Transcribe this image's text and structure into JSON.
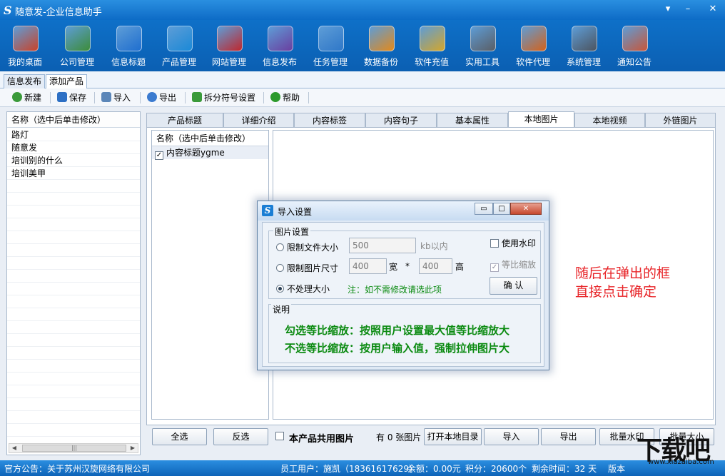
{
  "window": {
    "logo": "S",
    "title": "随意发-企业信息助手",
    "controls": [
      "▾",
      "–",
      "✕"
    ]
  },
  "main_toolbar": [
    {
      "label": "我的桌面",
      "icon": "home-icon",
      "color": "#c9442b"
    },
    {
      "label": "公司管理",
      "icon": "document-icon",
      "color": "#3d8d3a"
    },
    {
      "label": "信息标题",
      "icon": "info-icon",
      "color": "#1f6fd0"
    },
    {
      "label": "产品管理",
      "icon": "cloud-icon",
      "color": "#1b8ad8"
    },
    {
      "label": "网站管理",
      "icon": "building-icon",
      "color": "#c0282e"
    },
    {
      "label": "信息发布",
      "icon": "magic-wand-icon",
      "color": "#6b3fa0"
    },
    {
      "label": "任务管理",
      "icon": "bar-chart-icon",
      "color": "#2f78c9"
    },
    {
      "label": "数据备份",
      "icon": "upload-icon",
      "color": "#e38a1c"
    },
    {
      "label": "软件充值",
      "icon": "coins-icon",
      "color": "#d4a72c"
    },
    {
      "label": "实用工具",
      "icon": "tools-icon",
      "color": "#5b5f66"
    },
    {
      "label": "软件代理",
      "icon": "gift-icon",
      "color": "#d4631c"
    },
    {
      "label": "系统管理",
      "icon": "gear-icon",
      "color": "#4d5560"
    },
    {
      "label": "通知公告",
      "icon": "notebook-icon",
      "color": "#c8573a"
    }
  ],
  "outer_tabs": [
    "信息发布",
    "添加产品"
  ],
  "sub_toolbar": [
    {
      "label": "新建",
      "icon": "plus-icon",
      "color": "#3a9a3a"
    },
    {
      "label": "保存",
      "icon": "save-icon",
      "color": "#2c6fc4"
    },
    {
      "label": "导入",
      "icon": "folder-icon",
      "color": "#5b86b8"
    },
    {
      "label": "导出",
      "icon": "export-icon",
      "color": "#3b7bd0"
    },
    {
      "label": "拆分符号设置",
      "icon": "split-icon",
      "color": "#3a9a3a"
    },
    {
      "label": "帮助",
      "icon": "help-icon",
      "color": "#2c9a2c"
    }
  ],
  "left_list": {
    "header": "名称（选中后单击修改）",
    "items": [
      "路灯",
      "随意发",
      "培训别的什么",
      "培训美甲"
    ]
  },
  "right_tabs": [
    "产品标题",
    "详细介绍",
    "内容标签",
    "内容句子",
    "基本属性",
    "本地图片",
    "本地视频",
    "外链图片"
  ],
  "image_list": {
    "header": "名称（选中后单击修改）",
    "items": [
      {
        "label": "内容标题ygme",
        "checked": "✓"
      }
    ]
  },
  "bottom_buttons": {
    "select_all": "全选",
    "invert": "反选",
    "share_label": "本产品共用图片",
    "count_label": "有 0 张图片",
    "open_dir": "打开本地目录",
    "import": "导入",
    "export": "导出",
    "batch_watermark": "批量水印",
    "batch_size": "批量大小"
  },
  "dialog": {
    "logo": "S",
    "title": "导入设置",
    "controls": [
      "▭",
      "□",
      "✕"
    ],
    "group_label": "图片设置",
    "limit_file_size": "限制文件大小",
    "file_size_value": "500",
    "file_size_unit": "kb以内",
    "limit_image_size": "限制图片尺寸",
    "width_value": "400",
    "width_label": "宽",
    "times": "*",
    "height_value": "400",
    "height_label": "高",
    "no_resize": "不处理大小",
    "note": "注：如不需修改请选此项",
    "use_watermark": "使用水印",
    "proportional": "等比缩放",
    "proportional_check": "✓",
    "confirm": "确  认",
    "desc_label": "说明",
    "desc_line1": "勾选等比缩放：按照用户设置最大值等比缩放大",
    "desc_line2": "不选等比缩放：按用户输入值，强制拉伸图片大"
  },
  "annotation": {
    "line1": "随后在弹出的框",
    "line2": "直接点击确定"
  },
  "status": {
    "notice": "官方公告：关于苏州汉旋网络有限公司",
    "user": "员工用户：施凯（18361617629）",
    "balance": "余额：0.00元",
    "points": "积分：20600个",
    "remaining": "剩余时间：32 天",
    "version": "版本"
  },
  "watermark": {
    "big": "下载吧",
    "small": "www.xiazaiba.com"
  }
}
